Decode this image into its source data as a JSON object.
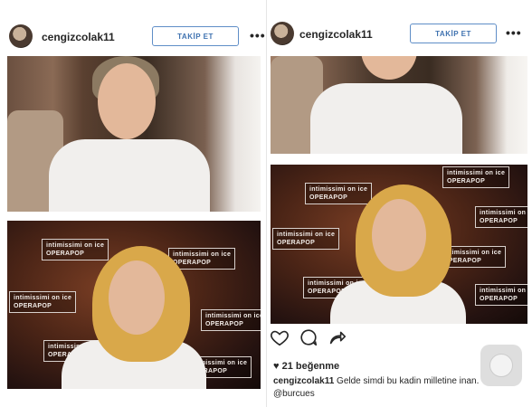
{
  "posts": [
    {
      "username": "cengizcolak11",
      "follow_label": "TAKİP ET",
      "more_label": "•••"
    },
    {
      "username": "cengizcolak11",
      "follow_label": "TAKİP ET",
      "more_label": "•••"
    }
  ],
  "backdrop_logos": [
    "intimissimi on ice\nOPERAPOP"
  ],
  "likes": "21 beğenme",
  "caption": {
    "username": "cengizcolak11",
    "text": " Gelde simdi bu kadin milletine inan.",
    "mention": "@burcues"
  },
  "icons": {
    "like": "heart-icon",
    "comment": "comment-icon",
    "share": "share-arrow-icon",
    "home": "home-button-icon"
  }
}
